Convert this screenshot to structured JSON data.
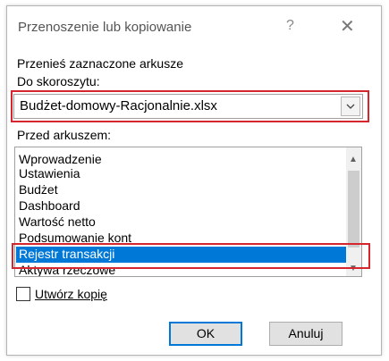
{
  "dialog": {
    "title": "Przenoszenie lub kopiowanie",
    "help": "?",
    "close": "✕"
  },
  "labels": {
    "move_selected": "Przenieś zaznaczone arkusze",
    "to_book": "Do skoroszytu:",
    "before_sheet": "Przed arkuszem:"
  },
  "workbook": {
    "selected": "Budżet-domowy-Racjonalnie.xlsx"
  },
  "sheets": {
    "items": [
      "Wprowadzenie",
      "Ustawienia",
      "Budżet",
      "Dashboard",
      "Wartość netto",
      "Podsumowanie kont",
      "Rejestr transakcji",
      "Aktywa rzeczowe"
    ],
    "selected_index": 6
  },
  "options": {
    "create_copy_label": "Utwórz kopię",
    "create_copy_checked": false
  },
  "buttons": {
    "ok": "OK",
    "cancel": "Anuluj"
  },
  "colors": {
    "highlight": "#d4262c",
    "selection": "#0078d7"
  }
}
